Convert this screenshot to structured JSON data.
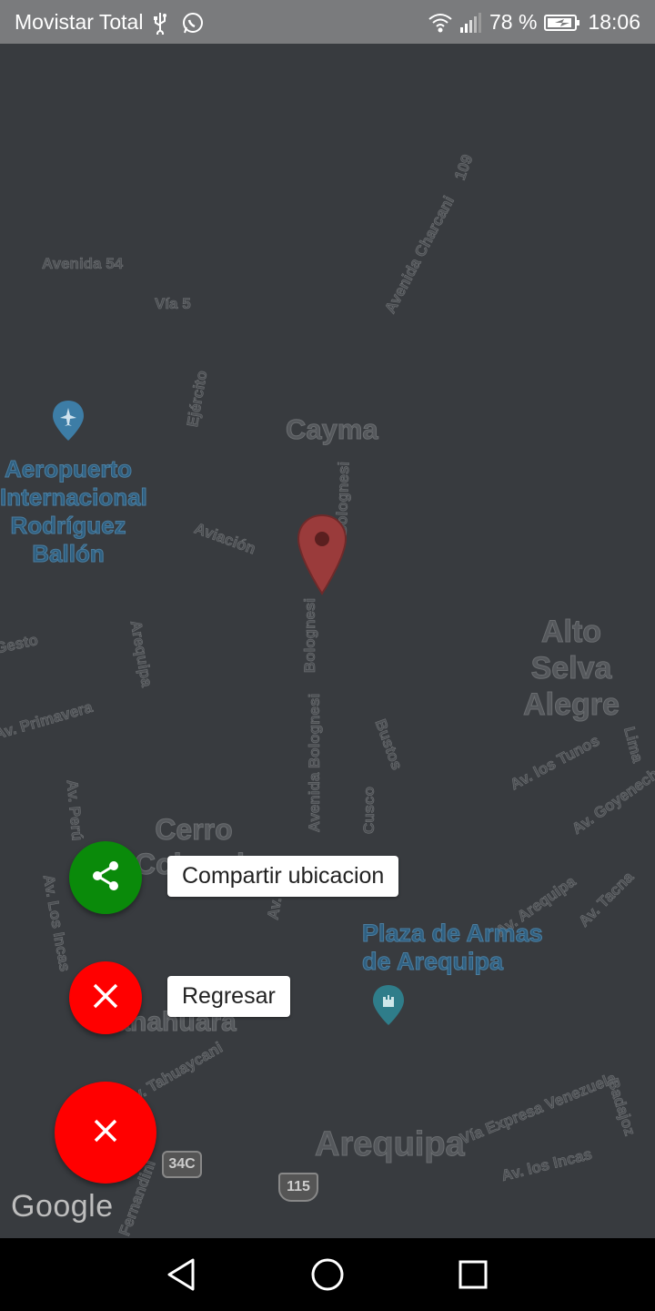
{
  "status_bar": {
    "carrier": "Movistar Total",
    "battery_percent": "78 %",
    "time": "18:06",
    "icons": [
      "usb-icon",
      "whatsapp-icon",
      "wifi-icon",
      "signal-icon",
      "battery-charging-icon"
    ]
  },
  "map": {
    "places": {
      "cayma": "Cayma",
      "airport": "Aeropuerto\nInternacional\nRodríguez\nBallón",
      "alto_selva_alegre": "Alto Selva\nAlegre",
      "cerro_colorado": "Cerro\nColorado",
      "plaza_de_armas": "Plaza de Armas\nde Arequipa",
      "yanahuara": "Yanahuara",
      "arequipa": "Arequipa"
    },
    "roads": {
      "avenida_54": "Avenida 54",
      "via_5": "Vía 5",
      "avenida_charcani": "Avenida Charcani",
      "r109": "109",
      "ejercito": "Ejército",
      "bolognesi_top": "Bolognesi",
      "aviacion": "Aviación",
      "bolognesi_mid": "Bolognesi",
      "avenida_bolognesi": "Avenida Bolognesi",
      "primavera": "Av. Primavera",
      "arequipa_left": "Arequipa",
      "peru": "Av. Perú",
      "los_incas": "Av. Los Incas",
      "los_tunos": "Av. los Tunos",
      "av_goyeneche": "Av. Goyeneche",
      "cusco": "Cusco",
      "av_tacna": "Av. Tacna",
      "via_evitamiento": "Vía Expresa Venezuela",
      "los_incas_bottom": "Av. los Incas",
      "tahuaycani": "Av. Tahuaycani",
      "badajoz": "Badajoz",
      "lima": "Lima",
      "shield_34c": "34C",
      "shield_115": "115"
    },
    "google_logo": "Google"
  },
  "fab_menu": {
    "share_label": "Compartir ubicacion",
    "back_label": "Regresar",
    "colors": {
      "share": "#0a8a0a",
      "back": "#ff0000",
      "main": "#ff0000"
    }
  }
}
